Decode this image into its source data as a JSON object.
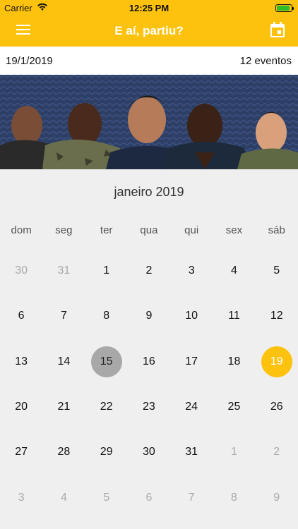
{
  "status_bar": {
    "carrier": "Carrier",
    "time": "12:25 PM"
  },
  "nav": {
    "title": "E aí, partiu?",
    "menu_icon": "hamburger-menu-icon",
    "calendar_icon": "calendar-icon"
  },
  "info_bar": {
    "date": "19/1/2019",
    "events_count": "12 eventos"
  },
  "colors": {
    "accent": "#fdc20e",
    "today_circle": "#a8a8a8",
    "banner_bg": "#2e3f66"
  },
  "calendar": {
    "month_label": "janeiro 2019",
    "weekdays": [
      "dom",
      "seg",
      "ter",
      "qua",
      "qui",
      "sex",
      "sáb"
    ],
    "weeks": [
      [
        {
          "d": "30",
          "o": true
        },
        {
          "d": "31",
          "o": true
        },
        {
          "d": "1"
        },
        {
          "d": "2"
        },
        {
          "d": "3"
        },
        {
          "d": "4"
        },
        {
          "d": "5"
        }
      ],
      [
        {
          "d": "6"
        },
        {
          "d": "7"
        },
        {
          "d": "8"
        },
        {
          "d": "9"
        },
        {
          "d": "10"
        },
        {
          "d": "11"
        },
        {
          "d": "12"
        }
      ],
      [
        {
          "d": "13"
        },
        {
          "d": "14"
        },
        {
          "d": "15",
          "today": true
        },
        {
          "d": "16"
        },
        {
          "d": "17"
        },
        {
          "d": "18"
        },
        {
          "d": "19",
          "selected": true
        }
      ],
      [
        {
          "d": "20"
        },
        {
          "d": "21"
        },
        {
          "d": "22"
        },
        {
          "d": "23"
        },
        {
          "d": "24"
        },
        {
          "d": "25"
        },
        {
          "d": "26"
        }
      ],
      [
        {
          "d": "27"
        },
        {
          "d": "28"
        },
        {
          "d": "29"
        },
        {
          "d": "30"
        },
        {
          "d": "31"
        },
        {
          "d": "1",
          "o": true
        },
        {
          "d": "2",
          "o": true
        }
      ],
      [
        {
          "d": "3",
          "o": true
        },
        {
          "d": "4",
          "o": true
        },
        {
          "d": "5",
          "o": true
        },
        {
          "d": "6",
          "o": true
        },
        {
          "d": "7",
          "o": true
        },
        {
          "d": "8",
          "o": true
        },
        {
          "d": "9",
          "o": true
        }
      ]
    ]
  }
}
